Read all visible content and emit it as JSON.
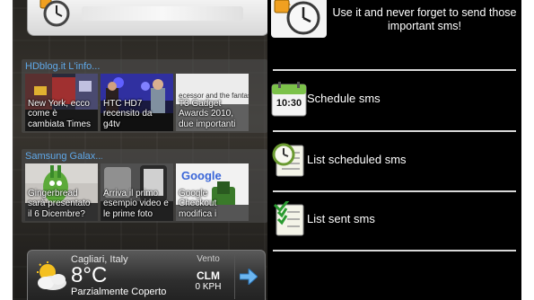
{
  "left_phone": {
    "news_widgets": [
      {
        "source": "HDblog.it L'info...",
        "items": [
          {
            "caption": "New York, ecco come è cambiata Times"
          },
          {
            "caption": "HTC HD7 recensito da g4tv"
          },
          {
            "caption": "T3 Gadget Awards 2010, due importanti",
            "image_text": "ecessor and the fantas"
          }
        ]
      },
      {
        "source": "Samsung Galax...",
        "items": [
          {
            "caption": "Gingerbread sarà presentato il 6 Dicembre?"
          },
          {
            "caption": "Arriva il primo esempio video e le prime foto"
          },
          {
            "caption": "Google Checkout modifica i",
            "image_text": "Google"
          }
        ]
      }
    ],
    "weather": {
      "city": "Cagliari, Italy",
      "temperature": "8°C",
      "condition": "Parzialmente Coperto",
      "wind_label": "Vento",
      "wind_direction": "CLM",
      "wind_speed": "0 KPH"
    }
  },
  "right_phone": {
    "header_text": "Use it and never forget to send those important sms!",
    "menu": [
      {
        "label": "Schedule sms",
        "icon": "calendar-icon",
        "icon_text": "10:30"
      },
      {
        "label": "List scheduled sms",
        "icon": "clock-list-icon"
      },
      {
        "label": "List sent sms",
        "icon": "checklist-icon"
      }
    ]
  },
  "colors": {
    "source_link": "#5fa8e8",
    "divider": "#d8d8d8",
    "app_background": "#000000"
  }
}
